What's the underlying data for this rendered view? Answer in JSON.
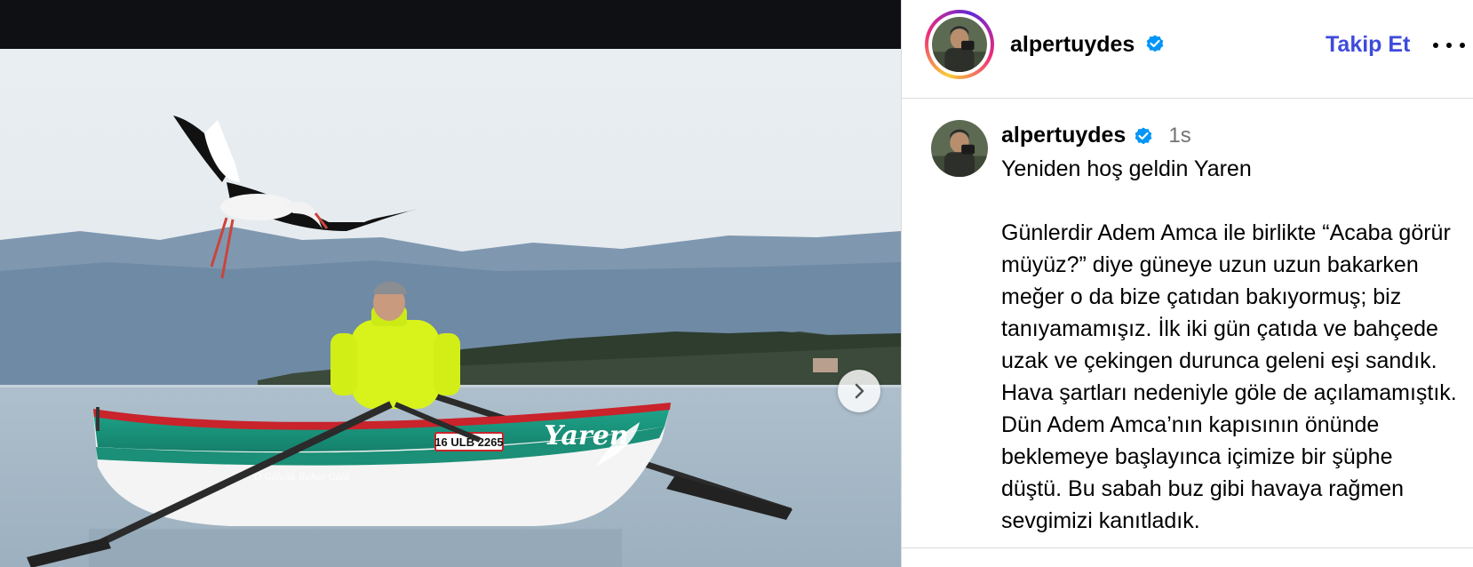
{
  "post": {
    "username": "alpertuydes",
    "follow_label": "Takip Et",
    "more_label": "More options",
    "next_label": "Next"
  },
  "caption": {
    "username": "alpertuydes",
    "time": "1s",
    "text": "Yeniden hoş geldin Yaren\n\nGünlerdir Adem Amca ile birlikte “Acaba görür müyüz?” diye güneye uzun uzun bakarken meğer o da bize çatıdan bakıyormuş; biz tanıyamamışız. İlk iki gün çatıda ve bahçede uzak ve çekingen durunca geleni eşi sandık. Hava şartları nedeniyle göle de açılamamıştık. Dün Adem Amca’nın kapısının önünde beklemeye başlayınca içimize bir şüphe düştü. Bu sabah buz gibi havaya rağmen sevgimizi kanıtladık."
  },
  "photo": {
    "boat_name": "Yaren",
    "boat_plate": "16 ULB 2265",
    "boat_side_text": "O Gölcük Bahar Gölü"
  },
  "colors": {
    "follow": "#3f4bdb",
    "verified": "#0095f6",
    "divider": "#dbdbdb",
    "muted": "#737373"
  },
  "icons": [
    "verified-badge-icon",
    "chevron-right-icon",
    "more-dots-icon"
  ]
}
